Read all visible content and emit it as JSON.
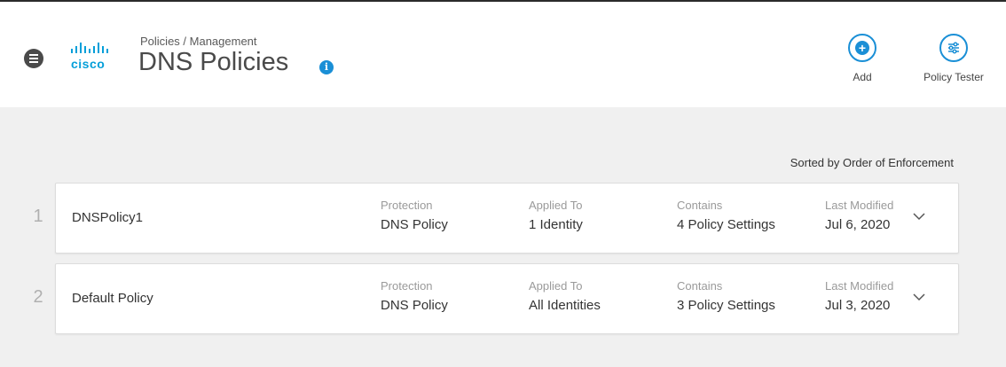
{
  "header": {
    "logo_text": "cisco",
    "breadcrumb": "Policies / Management",
    "title": "DNS Policies",
    "info_glyph": "i",
    "actions": [
      {
        "label": "Add",
        "icon": "plus-circle-icon"
      },
      {
        "label": "Policy Tester",
        "icon": "sliders-icon"
      }
    ]
  },
  "list": {
    "sort_label": "Sorted by Order of Enforcement",
    "columns": {
      "protection": "Protection",
      "applied_to": "Applied To",
      "contains": "Contains",
      "last_modified": "Last Modified"
    },
    "policies": [
      {
        "index": "1",
        "name": "DNSPolicy1",
        "protection": "DNS Policy",
        "applied_to": "1 Identity",
        "contains": "4 Policy Settings",
        "last_modified": "Jul 6, 2020"
      },
      {
        "index": "2",
        "name": "Default Policy",
        "protection": "DNS Policy",
        "applied_to": "All Identities",
        "contains": "3 Policy Settings",
        "last_modified": "Jul 3, 2020"
      }
    ]
  },
  "colors": {
    "accent": "#1a8fd6",
    "cisco_blue": "#049fd9",
    "background": "#f0f0f0"
  }
}
